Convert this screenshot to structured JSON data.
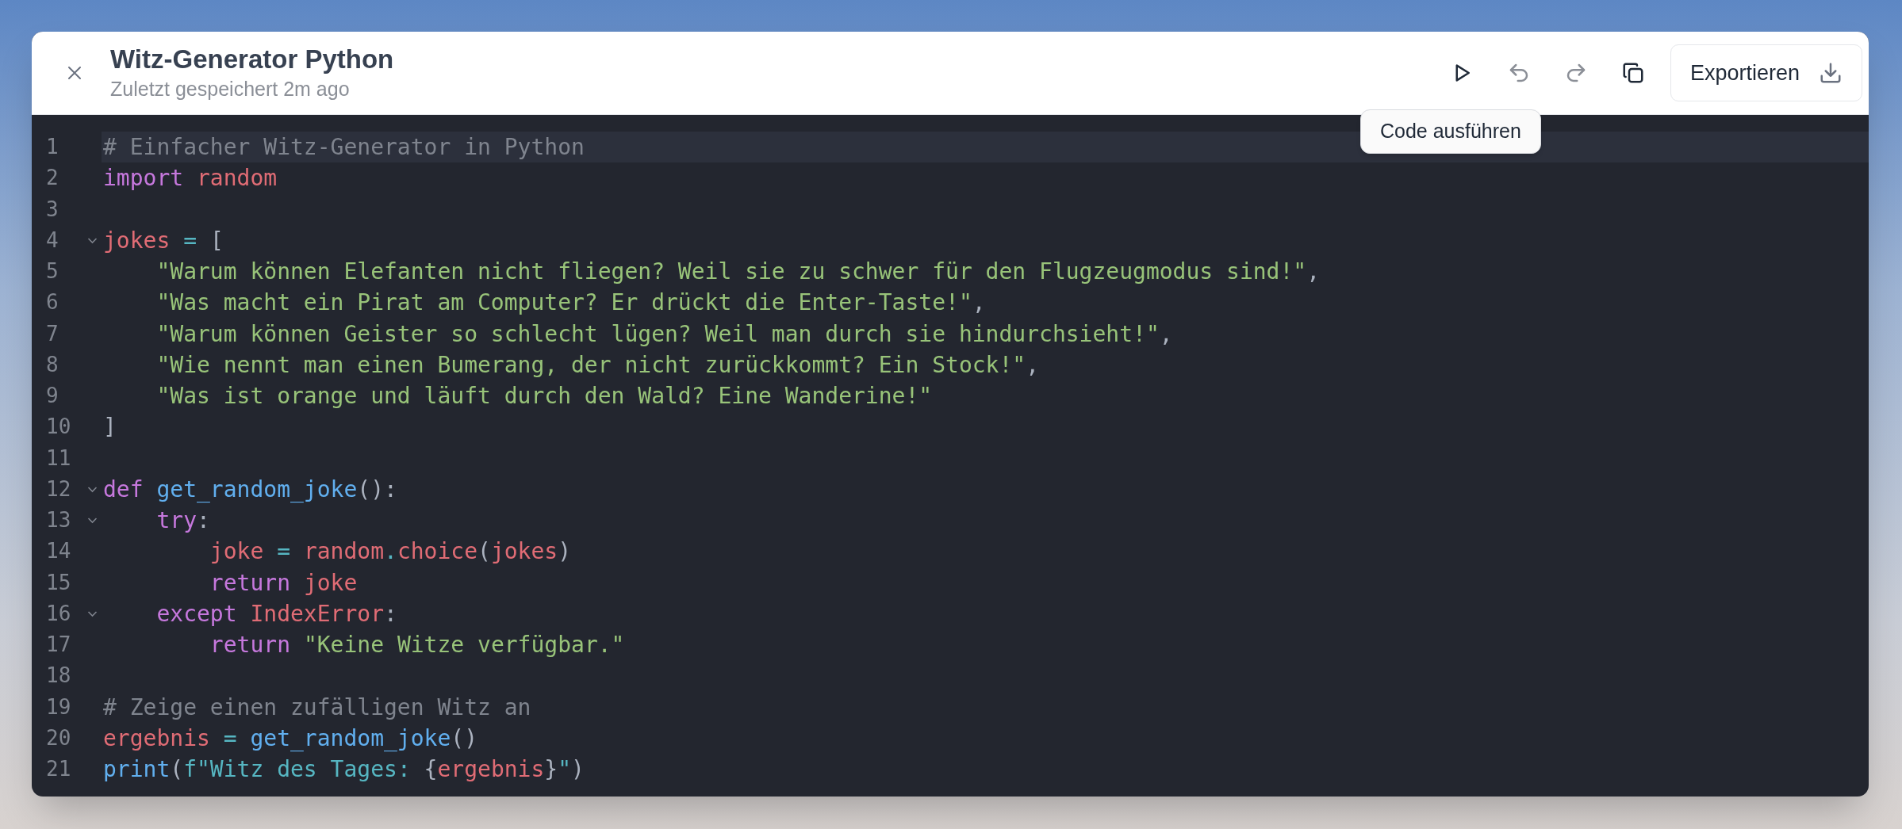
{
  "header": {
    "title": "Witz-Generator Python",
    "subtitle": "Zuletzt gespeichert 2m ago"
  },
  "toolbar": [
    {
      "kind": "run",
      "disabled": false
    },
    {
      "kind": "undo",
      "disabled": true
    },
    {
      "kind": "redo",
      "disabled": true
    },
    {
      "kind": "copy",
      "disabled": false
    }
  ],
  "export_button": {
    "label": "Exportieren"
  },
  "tooltip": {
    "text": "Code ausführen"
  },
  "editor": {
    "lines": [
      {
        "number": "1",
        "highlighted": true,
        "foldable": false,
        "tokens": [
          {
            "kind": "comment",
            "text": "# Einfacher Witz-Generator in Python"
          }
        ]
      },
      {
        "number": "2",
        "highlighted": false,
        "foldable": false,
        "tokens": [
          {
            "kind": "keyword",
            "text": "import "
          },
          {
            "kind": "variable",
            "text": "random"
          }
        ]
      },
      {
        "number": "3",
        "highlighted": false,
        "foldable": false
      },
      {
        "number": "4",
        "highlighted": false,
        "foldable": true,
        "tokens": [
          {
            "kind": "variable",
            "text": "jokes "
          },
          {
            "kind": "operator",
            "text": "= "
          },
          {
            "kind": "punct",
            "text": "["
          }
        ]
      },
      {
        "number": "5",
        "highlighted": false,
        "foldable": false,
        "tokens": [
          {
            "kind": "string",
            "text": "    \"Warum können Elefanten nicht fliegen? Weil sie zu schwer für den Flugzeugmodus sind!\""
          },
          {
            "kind": "punct",
            "text": ","
          }
        ]
      },
      {
        "number": "6",
        "highlighted": false,
        "foldable": false,
        "tokens": [
          {
            "kind": "string",
            "text": "    \"Was macht ein Pirat am Computer? Er drückt die Enter-Taste!\""
          },
          {
            "kind": "punct",
            "text": ","
          }
        ]
      },
      {
        "number": "7",
        "highlighted": false,
        "foldable": false,
        "tokens": [
          {
            "kind": "string",
            "text": "    \"Warum können Geister so schlecht lügen? Weil man durch sie hindurchsieht!\""
          },
          {
            "kind": "punct",
            "text": ","
          }
        ]
      },
      {
        "number": "8",
        "highlighted": false,
        "foldable": false,
        "tokens": [
          {
            "kind": "string",
            "text": "    \"Wie nennt man einen Bumerang, der nicht zurückkommt? Ein Stock!\""
          },
          {
            "kind": "punct",
            "text": ","
          }
        ]
      },
      {
        "number": "9",
        "highlighted": false,
        "foldable": false,
        "tokens": [
          {
            "kind": "string",
            "text": "    \"Was ist orange und läuft durch den Wald? Eine Wanderine!\""
          }
        ]
      },
      {
        "number": "10",
        "highlighted": false,
        "foldable": false,
        "tokens": [
          {
            "kind": "punct",
            "text": "]"
          }
        ]
      },
      {
        "number": "11",
        "highlighted": false,
        "foldable": false
      },
      {
        "number": "12",
        "highlighted": false,
        "foldable": true,
        "tokens": [
          {
            "kind": "keyword",
            "text": "def "
          },
          {
            "kind": "function",
            "text": "get_random_joke"
          },
          {
            "kind": "punct",
            "text": "():"
          }
        ]
      },
      {
        "number": "13",
        "highlighted": false,
        "foldable": true,
        "tokens": [
          {
            "kind": "keyword",
            "text": "    try"
          },
          {
            "kind": "punct",
            "text": ":"
          }
        ]
      },
      {
        "number": "14",
        "highlighted": false,
        "foldable": false,
        "tokens": [
          {
            "kind": "variable",
            "text": "        joke "
          },
          {
            "kind": "operator",
            "text": "= "
          },
          {
            "kind": "variable",
            "text": "random"
          },
          {
            "kind": "operator",
            "text": "."
          },
          {
            "kind": "variable",
            "text": "choice"
          },
          {
            "kind": "punct",
            "text": "("
          },
          {
            "kind": "variable",
            "text": "jokes"
          },
          {
            "kind": "punct",
            "text": ")"
          }
        ]
      },
      {
        "number": "15",
        "highlighted": false,
        "foldable": false,
        "tokens": [
          {
            "kind": "keyword",
            "text": "        return "
          },
          {
            "kind": "variable",
            "text": "joke"
          }
        ]
      },
      {
        "number": "16",
        "highlighted": false,
        "foldable": true,
        "tokens": [
          {
            "kind": "keyword",
            "text": "    except "
          },
          {
            "kind": "variable",
            "text": "IndexError"
          },
          {
            "kind": "punct",
            "text": ":"
          }
        ]
      },
      {
        "number": "17",
        "highlighted": false,
        "foldable": false,
        "tokens": [
          {
            "kind": "keyword",
            "text": "        return "
          },
          {
            "kind": "string",
            "text": "\"Keine Witze verfügbar.\""
          }
        ]
      },
      {
        "number": "18",
        "highlighted": false,
        "foldable": false
      },
      {
        "number": "19",
        "highlighted": false,
        "foldable": false,
        "tokens": [
          {
            "kind": "comment",
            "text": "# Zeige einen zufälligen Witz an"
          }
        ]
      },
      {
        "number": "20",
        "highlighted": false,
        "foldable": false,
        "tokens": [
          {
            "kind": "variable",
            "text": "ergebnis "
          },
          {
            "kind": "operator",
            "text": "= "
          },
          {
            "kind": "function",
            "text": "get_random_joke"
          },
          {
            "kind": "punct",
            "text": "()"
          }
        ]
      },
      {
        "number": "21",
        "highlighted": false,
        "foldable": false,
        "tokens": [
          {
            "kind": "function",
            "text": "print"
          },
          {
            "kind": "punct",
            "text": "("
          },
          {
            "kind": "fstring",
            "text": "f\"Witz des Tages: "
          },
          {
            "kind": "punct",
            "text": "{"
          },
          {
            "kind": "variable",
            "text": "ergebnis"
          },
          {
            "kind": "punct",
            "text": "}"
          },
          {
            "kind": "fstring",
            "text": "\""
          },
          {
            "kind": "punct",
            "text": ")"
          }
        ]
      }
    ]
  }
}
